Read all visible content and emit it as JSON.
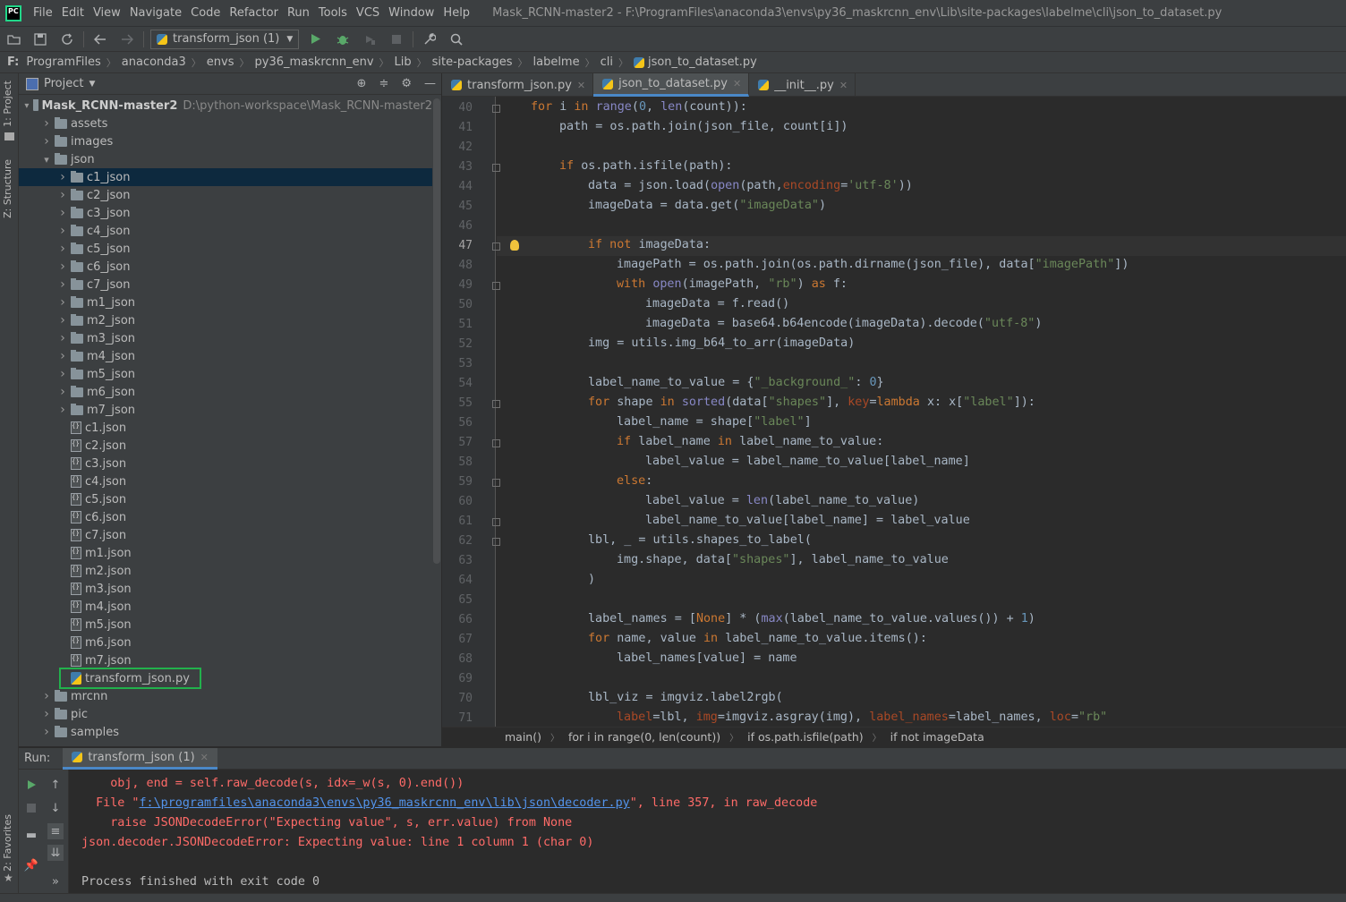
{
  "app": {
    "logo_text": "PC",
    "window_title": "Mask_RCNN-master2 - F:\\ProgramFiles\\anaconda3\\envs\\py36_maskrcnn_env\\Lib\\site-packages\\labelme\\cli\\json_to_dataset.py"
  },
  "menu": [
    "File",
    "Edit",
    "View",
    "Navigate",
    "Code",
    "Refactor",
    "Run",
    "Tools",
    "VCS",
    "Window",
    "Help"
  ],
  "toolbar": {
    "run_config": "transform_json (1)",
    "icons": [
      "open-icon",
      "save-icon",
      "sync-icon",
      "back-icon",
      "forward-icon",
      "run-icon",
      "debug-icon",
      "coverage-icon",
      "stop-icon",
      "settings-wrench-icon",
      "search-icon"
    ]
  },
  "navbar": {
    "drive": "F:",
    "crumbs": [
      "ProgramFiles",
      "anaconda3",
      "envs",
      "py36_maskrcnn_env",
      "Lib",
      "site-packages",
      "labelme",
      "cli",
      "json_to_dataset.py"
    ]
  },
  "left_stripe": {
    "project": "1: Project",
    "structure": "Z: Structure",
    "favorites": "2: Favorites"
  },
  "project": {
    "header": "Project",
    "root_name": "Mask_RCNN-master2",
    "root_path": "D:\\python-workspace\\Mask_RCNN-master2",
    "rows": [
      {
        "label": "assets",
        "kind": "folder",
        "depth": 1,
        "expanded": false
      },
      {
        "label": "images",
        "kind": "folder",
        "depth": 1,
        "expanded": false
      },
      {
        "label": "json",
        "kind": "folder",
        "depth": 1,
        "expanded": true
      },
      {
        "label": "c1_json",
        "kind": "folder",
        "depth": 2,
        "expanded": false,
        "selected": true
      },
      {
        "label": "c2_json",
        "kind": "folder",
        "depth": 2,
        "expanded": false
      },
      {
        "label": "c3_json",
        "kind": "folder",
        "depth": 2,
        "expanded": false
      },
      {
        "label": "c4_json",
        "kind": "folder",
        "depth": 2,
        "expanded": false
      },
      {
        "label": "c5_json",
        "kind": "folder",
        "depth": 2,
        "expanded": false
      },
      {
        "label": "c6_json",
        "kind": "folder",
        "depth": 2,
        "expanded": false
      },
      {
        "label": "c7_json",
        "kind": "folder",
        "depth": 2,
        "expanded": false
      },
      {
        "label": "m1_json",
        "kind": "folder",
        "depth": 2,
        "expanded": false
      },
      {
        "label": "m2_json",
        "kind": "folder",
        "depth": 2,
        "expanded": false
      },
      {
        "label": "m3_json",
        "kind": "folder",
        "depth": 2,
        "expanded": false
      },
      {
        "label": "m4_json",
        "kind": "folder",
        "depth": 2,
        "expanded": false
      },
      {
        "label": "m5_json",
        "kind": "folder",
        "depth": 2,
        "expanded": false
      },
      {
        "label": "m6_json",
        "kind": "folder",
        "depth": 2,
        "expanded": false
      },
      {
        "label": "m7_json",
        "kind": "folder",
        "depth": 2,
        "expanded": false
      },
      {
        "label": "c1.json",
        "kind": "json",
        "depth": 2
      },
      {
        "label": "c2.json",
        "kind": "json",
        "depth": 2
      },
      {
        "label": "c3.json",
        "kind": "json",
        "depth": 2
      },
      {
        "label": "c4.json",
        "kind": "json",
        "depth": 2
      },
      {
        "label": "c5.json",
        "kind": "json",
        "depth": 2
      },
      {
        "label": "c6.json",
        "kind": "json",
        "depth": 2
      },
      {
        "label": "c7.json",
        "kind": "json",
        "depth": 2
      },
      {
        "label": "m1.json",
        "kind": "json",
        "depth": 2
      },
      {
        "label": "m2.json",
        "kind": "json",
        "depth": 2
      },
      {
        "label": "m3.json",
        "kind": "json",
        "depth": 2
      },
      {
        "label": "m4.json",
        "kind": "json",
        "depth": 2
      },
      {
        "label": "m5.json",
        "kind": "json",
        "depth": 2
      },
      {
        "label": "m6.json",
        "kind": "json",
        "depth": 2
      },
      {
        "label": "m7.json",
        "kind": "json",
        "depth": 2
      },
      {
        "label": "transform_json.py",
        "kind": "py",
        "depth": 2
      },
      {
        "label": "mrcnn",
        "kind": "folder",
        "depth": 1,
        "expanded": false
      },
      {
        "label": "pic",
        "kind": "folder",
        "depth": 1,
        "expanded": false
      },
      {
        "label": "samples",
        "kind": "folder",
        "depth": 1,
        "expanded": false
      }
    ]
  },
  "editor": {
    "tabs": [
      {
        "label": "transform_json.py",
        "active": false
      },
      {
        "label": "json_to_dataset.py",
        "active": true
      },
      {
        "label": "__init__.py",
        "active": false
      }
    ],
    "current_line": 47,
    "lines": [
      {
        "n": 40,
        "html": "<span class=\"kw\">for </span>i <span class=\"kw\">in </span><span class=\"bi\">range</span>(<span class=\"num\">0</span>, <span class=\"bi\">len</span>(count)):",
        "indent": 0
      },
      {
        "n": 41,
        "html": "path = os.path.join(json_file, count[i])",
        "indent": 1
      },
      {
        "n": 42,
        "html": "",
        "indent": 0
      },
      {
        "n": 43,
        "html": "<span class=\"kw\">if </span>os.path.isfile(path):",
        "indent": 1
      },
      {
        "n": 44,
        "html": "data = json.load(<span class=\"bi\">open</span>(path,<span class=\"kwarg\">encoding</span>=<span class=\"str\">'utf-8'</span>))",
        "indent": 2
      },
      {
        "n": 45,
        "html": "imageData = data.get(<span class=\"str\">\"imageData\"</span>)",
        "indent": 2
      },
      {
        "n": 46,
        "html": "",
        "indent": 0
      },
      {
        "n": 47,
        "html": "<span class=\"kw\">if not </span>imageData:",
        "indent": 2
      },
      {
        "n": 48,
        "html": "imagePath = os.path.join(os.path.dirname(json_file), data[<span class=\"str\">\"imagePath\"</span>])",
        "indent": 3
      },
      {
        "n": 49,
        "html": "<span class=\"kw\">with </span><span class=\"bi\">open</span>(imagePath, <span class=\"str\">\"rb\"</span>) <span class=\"kw\">as </span>f:",
        "indent": 3
      },
      {
        "n": 50,
        "html": "imageData = f.read()",
        "indent": 4
      },
      {
        "n": 51,
        "html": "imageData = base64.b64encode(imageData).decode(<span class=\"str\">\"utf-8\"</span>)",
        "indent": 4
      },
      {
        "n": 52,
        "html": "img = utils.img_b64_to_arr(imageData)",
        "indent": 2
      },
      {
        "n": 53,
        "html": "",
        "indent": 0
      },
      {
        "n": 54,
        "html": "label_name_to_value = {<span class=\"str\">\"_background_\"</span>: <span class=\"num\">0</span>}",
        "indent": 2
      },
      {
        "n": 55,
        "html": "<span class=\"kw\">for </span>shape <span class=\"kw\">in </span><span class=\"bi\">sorted</span>(data[<span class=\"str\">\"shapes\"</span>], <span class=\"kwarg\">key</span>=<span class=\"kw\">lambda </span>x: x[<span class=\"str\">\"label\"</span>]):",
        "indent": 2
      },
      {
        "n": 56,
        "html": "label_name = shape[<span class=\"str\">\"label\"</span>]",
        "indent": 3
      },
      {
        "n": 57,
        "html": "<span class=\"kw\">if </span>label_name <span class=\"kw\">in </span>label_name_to_value:",
        "indent": 3
      },
      {
        "n": 58,
        "html": "label_value = label_name_to_value[label_name]",
        "indent": 4
      },
      {
        "n": 59,
        "html": "<span class=\"kw\">else</span>:",
        "indent": 3
      },
      {
        "n": 60,
        "html": "label_value = <span class=\"bi\">len</span>(label_name_to_value)",
        "indent": 4
      },
      {
        "n": 61,
        "html": "label_name_to_value[label_name] = label_value",
        "indent": 4
      },
      {
        "n": 62,
        "html": "lbl, _ = utils.shapes_to_label(",
        "indent": 2
      },
      {
        "n": 63,
        "html": "img.shape, data[<span class=\"str\">\"shapes\"</span>], label_name_to_value",
        "indent": 3
      },
      {
        "n": 64,
        "html": ")",
        "indent": 2
      },
      {
        "n": 65,
        "html": "",
        "indent": 0
      },
      {
        "n": 66,
        "html": "label_names = [<span class=\"kw\">None</span>] * (<span class=\"bi\">max</span>(label_name_to_value.values()) + <span class=\"num\">1</span>)",
        "indent": 2
      },
      {
        "n": 67,
        "html": "<span class=\"kw\">for </span>name, value <span class=\"kw\">in </span>label_name_to_value.items():",
        "indent": 2
      },
      {
        "n": 68,
        "html": "label_names[value] = name",
        "indent": 3
      },
      {
        "n": 69,
        "html": "",
        "indent": 0
      },
      {
        "n": 70,
        "html": "lbl_viz = imgviz.label2rgb(",
        "indent": 2
      },
      {
        "n": 71,
        "html": "<span class=\"kwarg\">label</span>=lbl, <span class=\"kwarg\">img</span>=imgviz.asgray(img), <span class=\"kwarg\">label_names</span>=label_names, <span class=\"kwarg\">loc</span>=<span class=\"str\">\"rb\"</span>",
        "indent": 3
      }
    ],
    "fold_markers": [
      40,
      43,
      47,
      49,
      55,
      57,
      59,
      61,
      62
    ],
    "crumbs": [
      "main()",
      "for i in range(0, len(count))",
      "if os.path.isfile(path)",
      "if not imageData"
    ]
  },
  "run": {
    "label": "Run:",
    "tab": "transform_json (1)",
    "console": [
      {
        "type": "err",
        "text": "    obj, end = self.raw_decode(s, idx=_w(s, 0).end())"
      },
      {
        "type": "err-link",
        "pre": "  File \"",
        "link": "f:\\programfiles\\anaconda3\\envs\\py36_maskrcnn_env\\lib\\json\\decoder.py",
        "post": "\", line 357, in raw_decode"
      },
      {
        "type": "err",
        "text": "    raise JSONDecodeError(\"Expecting value\", s, err.value) from None"
      },
      {
        "type": "err",
        "text": "json.decoder.JSONDecodeError: Expecting value: line 1 column 1 (char 0)"
      },
      {
        "type": "plain",
        "text": ""
      },
      {
        "type": "plain",
        "text": "Process finished with exit code 0"
      }
    ]
  },
  "colors": {
    "accent": "#4a88c7",
    "selection": "#0d293e",
    "highlight_box": "#22b14c",
    "error": "#ff6b68"
  }
}
